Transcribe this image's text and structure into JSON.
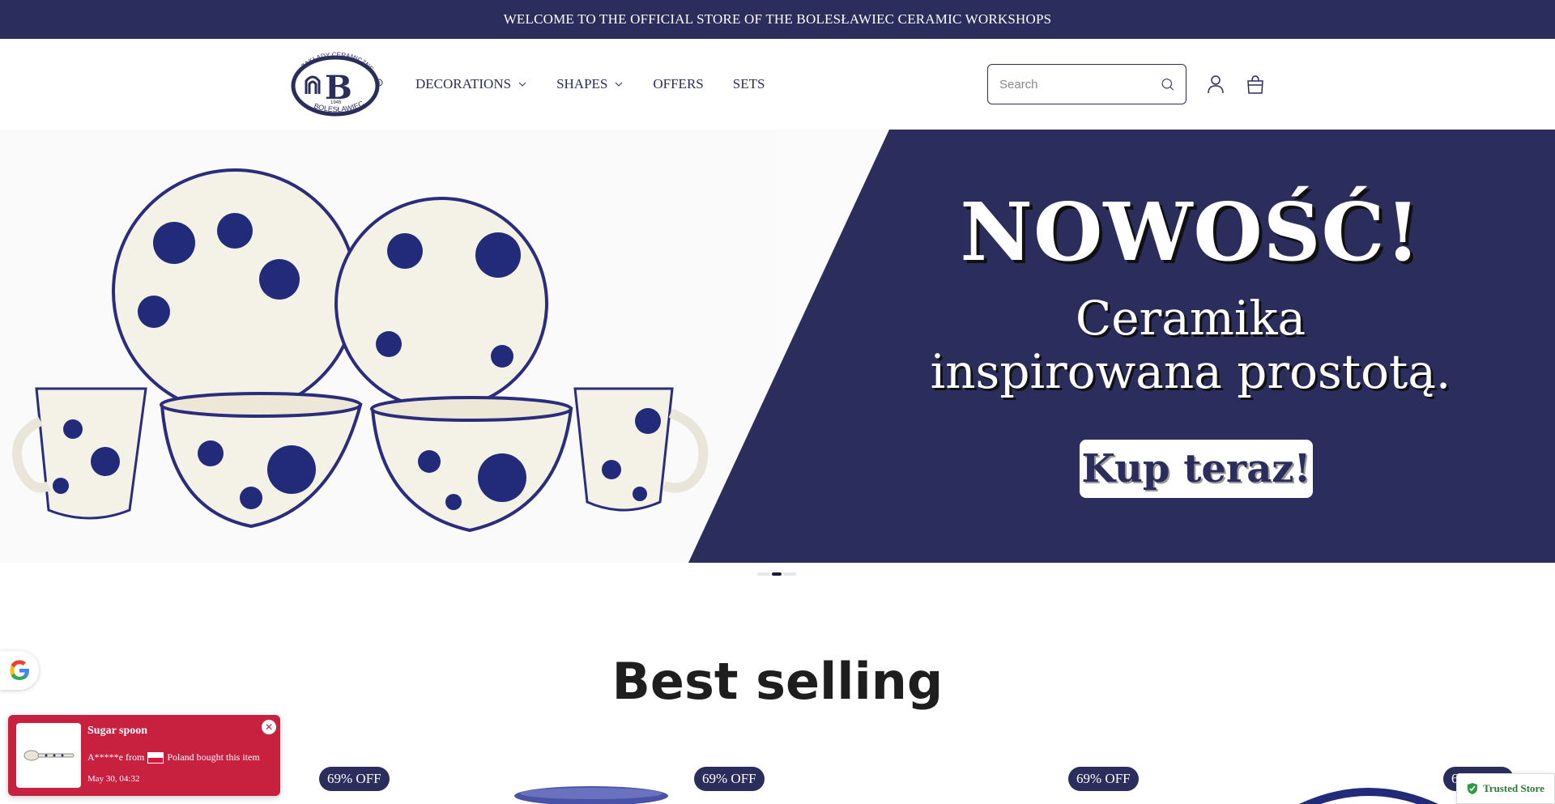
{
  "announcement": {
    "text": "WELCOME TO THE OFFICIAL STORE OF THE BOLESŁAWIEC CERAMIC WORKSHOPS"
  },
  "logo": {
    "top_text": "ZAKŁADY CERAMICZNE",
    "year": "1946",
    "bottom_text": "BOLESŁAWIEC",
    "letter": "B"
  },
  "nav": {
    "items": [
      {
        "label": "DECORATIONS",
        "has_dropdown": true
      },
      {
        "label": "SHAPES",
        "has_dropdown": true
      },
      {
        "label": "OFFERS",
        "has_dropdown": false
      },
      {
        "label": "SETS",
        "has_dropdown": false
      }
    ]
  },
  "search": {
    "placeholder": "Search",
    "value": ""
  },
  "icons": {
    "search": "search-icon",
    "account": "user-icon",
    "cart": "shopping-bag-icon"
  },
  "hero": {
    "title": "NOWOŚĆ!",
    "subtitle_line1": "Ceramika",
    "subtitle_line2": "inspirowana prostotą.",
    "cta": "Kup teraz!",
    "slide_count": 3,
    "active_slide": 2
  },
  "best_selling": {
    "title": "Best selling",
    "badges": [
      "69% OFF",
      "69% OFF",
      "69% OFF",
      "69% OFF"
    ]
  },
  "popup": {
    "product": "Sugar spoon",
    "buyer": "A*****e from",
    "country_text": "Poland bought this item",
    "time": "May 30, 04:32",
    "close": "✕"
  },
  "trusted": {
    "label": "Trusted Store"
  },
  "colors": {
    "brand_navy": "#2b2d5c",
    "popup_red": "#c8203f",
    "trusted_green": "#2d7a3a"
  }
}
